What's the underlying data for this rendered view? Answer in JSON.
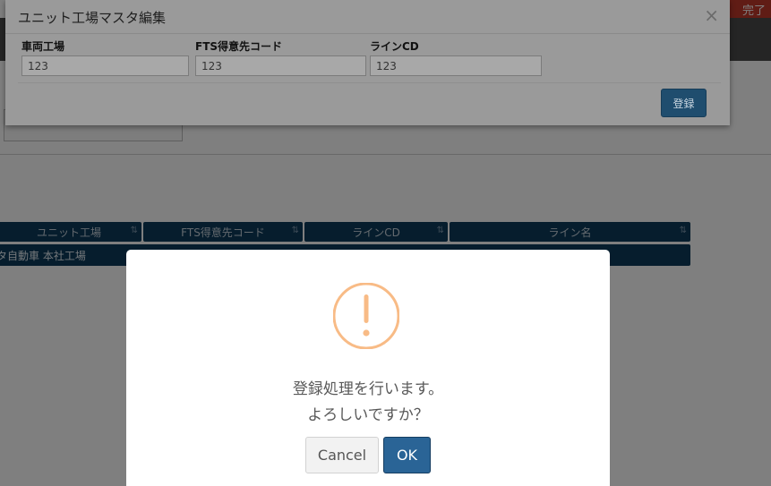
{
  "background_page": {
    "top_right_text": "完了",
    "grid": {
      "columns": [
        {
          "label": "ユニット工場"
        },
        {
          "label": "FTS得意先コード"
        },
        {
          "label": "ラインCD"
        },
        {
          "label": "ライン名"
        }
      ],
      "first_row_text": "タ自動車 本社工場",
      "sort_glyph": "⇅"
    }
  },
  "edit_modal": {
    "title": "ユニット工場マスタ編集",
    "close_glyph": "×",
    "fields": [
      {
        "label": "車両工場",
        "value": "123"
      },
      {
        "label": "FTS得意先コード",
        "value": "123"
      },
      {
        "label": "ラインCD",
        "value": "123"
      }
    ],
    "register_label": "登録"
  },
  "confirm_dialog": {
    "icon": "warning-icon",
    "icon_color": "#f8bb86",
    "message_line1": "登録処理を行います。",
    "message_line2": "よろしいですか？",
    "cancel_label": "Cancel",
    "ok_label": "OK",
    "ok_color": "#2a6496"
  }
}
